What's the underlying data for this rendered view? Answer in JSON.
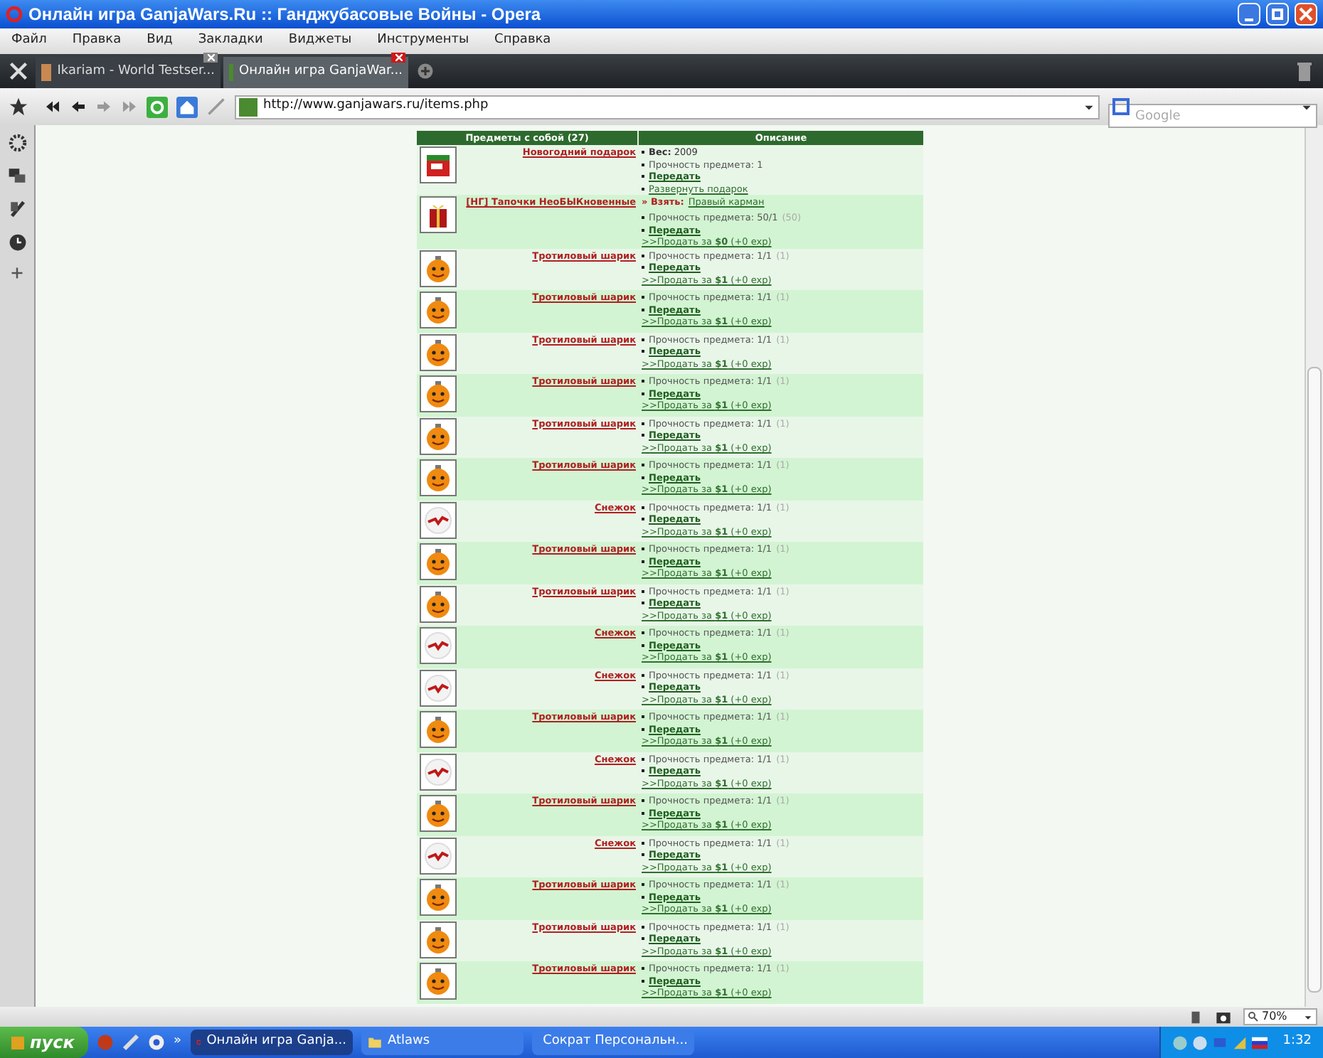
{
  "window": {
    "title": "Онлайн игра GanjaWars.Ru :: Ганджубасовые Войны - Opera"
  },
  "menu": [
    "Файл",
    "Правка",
    "Вид",
    "Закладки",
    "Виджеты",
    "Инструменты",
    "Справка"
  ],
  "tabs": [
    {
      "label": "Ikariam - World Testser...",
      "selected": false
    },
    {
      "label": "Онлайн игра GanjaWar...",
      "selected": true
    }
  ],
  "address": {
    "url": "http://www.ganjawars.ru/items.php"
  },
  "search": {
    "placeholder": "Google"
  },
  "table": {
    "columns": [
      "Предметы с собой (27)",
      "Описание"
    ],
    "rows": [
      {
        "kind": "present",
        "name": "Новогодний подарок",
        "details": [
          {
            "kind": "text",
            "text": "**Вес:** 2009"
          },
          {
            "kind": "stat",
            "text": "Прочность предмета: 1"
          },
          {
            "kind": "link",
            "text": "Передать"
          },
          {
            "kind": "plainlink",
            "text": "Развернуть подарок"
          }
        ]
      },
      {
        "kind": "gift",
        "name": "[НГ] Тапочки НеоБЫКновенные",
        "take": {
          "label": "» Взять:",
          "link": "Правый карман"
        },
        "details": [
          {
            "kind": "stat",
            "text": "Прочность предмета: 50/1",
            "extra": "(50)"
          },
          {
            "kind": "link",
            "text": "Передать"
          },
          {
            "kind": "sell",
            "text": ">>Продать за **$0** (+0 exp)"
          }
        ]
      },
      {
        "kind": "bomb",
        "name": "Тротиловый шарик",
        "details": [
          {
            "kind": "stat",
            "text": "Прочность предмета: 1/1",
            "extra": "(1)"
          },
          {
            "kind": "link",
            "text": "Передать"
          },
          {
            "kind": "sell",
            "text": ">>Продать за **$1** (+0 exp)"
          }
        ]
      },
      {
        "kind": "bomb",
        "name": "Тротиловый шарик",
        "details": [
          {
            "kind": "stat",
            "text": "Прочность предмета: 1/1",
            "extra": "(1)"
          },
          {
            "kind": "link",
            "text": "Передать"
          },
          {
            "kind": "sell",
            "text": ">>Продать за **$1** (+0 exp)"
          }
        ]
      },
      {
        "kind": "bomb",
        "name": "Тротиловый шарик",
        "details": [
          {
            "kind": "stat",
            "text": "Прочность предмета: 1/1",
            "extra": "(1)"
          },
          {
            "kind": "link",
            "text": "Передать"
          },
          {
            "kind": "sell",
            "text": ">>Продать за **$1** (+0 exp)"
          }
        ]
      },
      {
        "kind": "bomb",
        "name": "Тротиловый шарик",
        "details": [
          {
            "kind": "stat",
            "text": "Прочность предмета: 1/1",
            "extra": "(1)"
          },
          {
            "kind": "link",
            "text": "Передать"
          },
          {
            "kind": "sell",
            "text": ">>Продать за **$1** (+0 exp)"
          }
        ]
      },
      {
        "kind": "bomb",
        "name": "Тротиловый шарик",
        "details": [
          {
            "kind": "stat",
            "text": "Прочность предмета: 1/1",
            "extra": "(1)"
          },
          {
            "kind": "link",
            "text": "Передать"
          },
          {
            "kind": "sell",
            "text": ">>Продать за **$1** (+0 exp)"
          }
        ]
      },
      {
        "kind": "bomb",
        "name": "Тротиловый шарик",
        "details": [
          {
            "kind": "stat",
            "text": "Прочность предмета: 1/1",
            "extra": "(1)"
          },
          {
            "kind": "link",
            "text": "Передать"
          },
          {
            "kind": "sell",
            "text": ">>Продать за **$1** (+0 exp)"
          }
        ]
      },
      {
        "kind": "snowball",
        "name": "Снежок",
        "details": [
          {
            "kind": "stat",
            "text": "Прочность предмета: 1/1",
            "extra": "(1)"
          },
          {
            "kind": "link",
            "text": "Передать"
          },
          {
            "kind": "sell",
            "text": ">>Продать за **$1** (+0 exp)"
          }
        ]
      },
      {
        "kind": "bomb",
        "name": "Тротиловый шарик",
        "details": [
          {
            "kind": "stat",
            "text": "Прочность предмета: 1/1",
            "extra": "(1)"
          },
          {
            "kind": "link",
            "text": "Передать"
          },
          {
            "kind": "sell",
            "text": ">>Продать за **$1** (+0 exp)"
          }
        ]
      },
      {
        "kind": "bomb",
        "name": "Тротиловый шарик",
        "details": [
          {
            "kind": "stat",
            "text": "Прочность предмета: 1/1",
            "extra": "(1)"
          },
          {
            "kind": "link",
            "text": "Передать"
          },
          {
            "kind": "sell",
            "text": ">>Продать за **$1** (+0 exp)"
          }
        ]
      },
      {
        "kind": "snowball",
        "name": "Снежок",
        "details": [
          {
            "kind": "stat",
            "text": "Прочность предмета: 1/1",
            "extra": "(1)"
          },
          {
            "kind": "link",
            "text": "Передать"
          },
          {
            "kind": "sell",
            "text": ">>Продать за **$1** (+0 exp)"
          }
        ]
      },
      {
        "kind": "snowball",
        "name": "Снежок",
        "details": [
          {
            "kind": "stat",
            "text": "Прочность предмета: 1/1",
            "extra": "(1)"
          },
          {
            "kind": "link",
            "text": "Передать"
          },
          {
            "kind": "sell",
            "text": ">>Продать за **$1** (+0 exp)"
          }
        ]
      },
      {
        "kind": "bomb",
        "name": "Тротиловый шарик",
        "details": [
          {
            "kind": "stat",
            "text": "Прочность предмета: 1/1",
            "extra": "(1)"
          },
          {
            "kind": "link",
            "text": "Передать"
          },
          {
            "kind": "sell",
            "text": ">>Продать за **$1** (+0 exp)"
          }
        ]
      },
      {
        "kind": "snowball",
        "name": "Снежок",
        "details": [
          {
            "kind": "stat",
            "text": "Прочность предмета: 1/1",
            "extra": "(1)"
          },
          {
            "kind": "link",
            "text": "Передать"
          },
          {
            "kind": "sell",
            "text": ">>Продать за **$1** (+0 exp)"
          }
        ]
      },
      {
        "kind": "bomb",
        "name": "Тротиловый шарик",
        "details": [
          {
            "kind": "stat",
            "text": "Прочность предмета: 1/1",
            "extra": "(1)"
          },
          {
            "kind": "link",
            "text": "Передать"
          },
          {
            "kind": "sell",
            "text": ">>Продать за **$1** (+0 exp)"
          }
        ]
      },
      {
        "kind": "snowball",
        "name": "Снежок",
        "details": [
          {
            "kind": "stat",
            "text": "Прочность предмета: 1/1",
            "extra": "(1)"
          },
          {
            "kind": "link",
            "text": "Передать"
          },
          {
            "kind": "sell",
            "text": ">>Продать за **$1** (+0 exp)"
          }
        ]
      },
      {
        "kind": "bomb",
        "name": "Тротиловый шарик",
        "details": [
          {
            "kind": "stat",
            "text": "Прочность предмета: 1/1",
            "extra": "(1)"
          },
          {
            "kind": "link",
            "text": "Передать"
          },
          {
            "kind": "sell",
            "text": ">>Продать за **$1** (+0 exp)"
          }
        ]
      },
      {
        "kind": "bomb",
        "name": "Тротиловый шарик",
        "details": [
          {
            "kind": "stat",
            "text": "Прочность предмета: 1/1",
            "extra": "(1)"
          },
          {
            "kind": "link",
            "text": "Передать"
          },
          {
            "kind": "sell",
            "text": ">>Продать за **$1** (+0 exp)"
          }
        ]
      },
      {
        "kind": "bomb",
        "name": "Тротиловый шарик",
        "details": [
          {
            "kind": "stat",
            "text": "Прочность предмета: 1/1",
            "extra": "(1)"
          },
          {
            "kind": "link",
            "text": "Передать"
          },
          {
            "kind": "sell",
            "text": ">>Продать за **$1** (+0 exp)"
          }
        ]
      }
    ]
  },
  "status_bar": {
    "zoom": "70%"
  },
  "taskbar": {
    "start": "пуск",
    "more": "»",
    "tasks": [
      {
        "label": "Онлайн игра Ganja...",
        "kind": "browser",
        "selected": true
      },
      {
        "label": "Atlaws",
        "kind": "folder",
        "selected": false
      },
      {
        "label": "Сократ Персональн...",
        "kind": "app",
        "selected": false
      }
    ],
    "clock": "1:32"
  }
}
